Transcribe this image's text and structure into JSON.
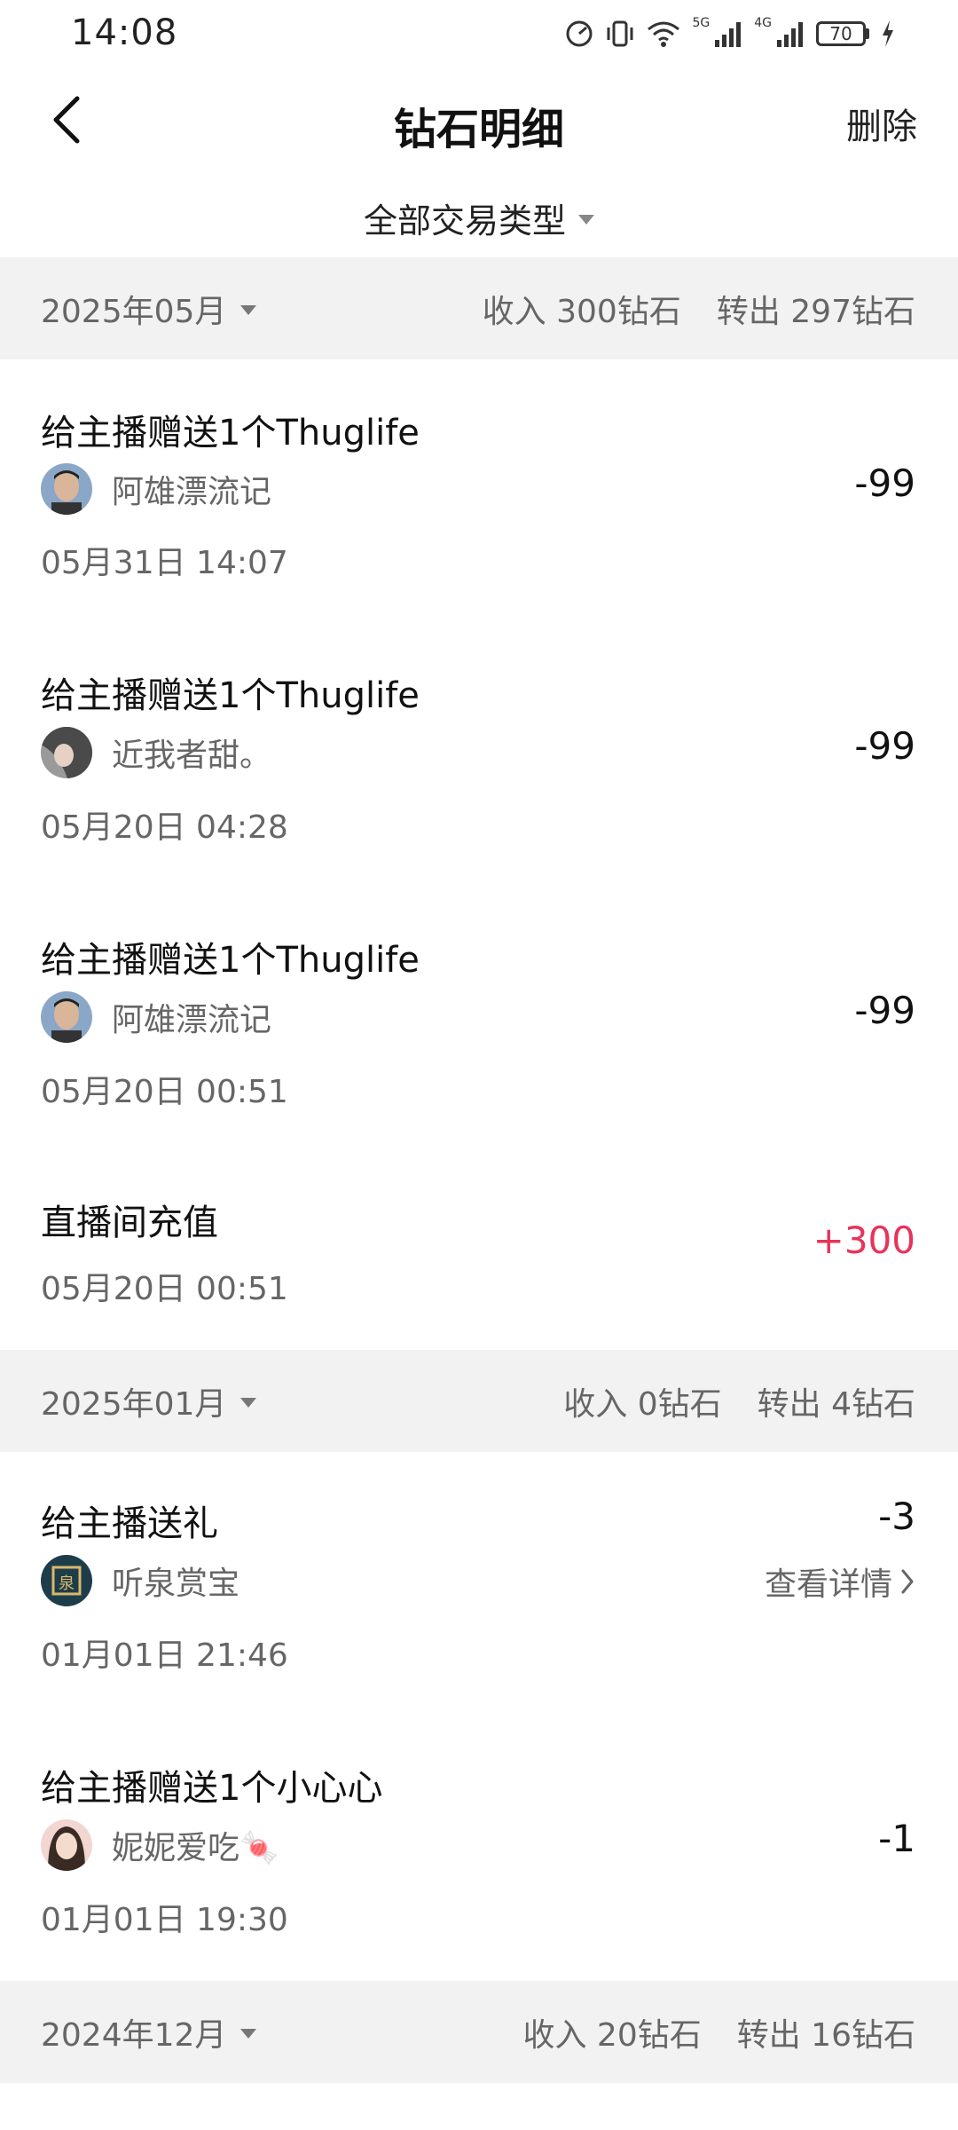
{
  "status_bar": {
    "time": "14:08",
    "battery": "70",
    "net_5g": "5G",
    "net_4g": "4G"
  },
  "header": {
    "title": "钻石明细",
    "delete_label": "删除",
    "back_icon": "chevron-left-icon"
  },
  "filter": {
    "label": "全部交易类型"
  },
  "months": [
    {
      "label": "2025年05月",
      "income": "收入 300钻石",
      "outgo": "转出 297钻石"
    },
    {
      "label": "2025年01月",
      "income": "收入 0钻石",
      "outgo": "转出 4钻石"
    },
    {
      "label": "2024年12月",
      "income": "收入 20钻石",
      "outgo": "转出 16钻石"
    }
  ],
  "transactions": [
    {
      "title": "给主播赠送1个Thuglife",
      "user": "阿雄漂流记",
      "time": "05月31日 14:07",
      "amount": "-99"
    },
    {
      "title": "给主播赠送1个Thuglife",
      "user": "近我者甜。",
      "time": "05月20日 04:28",
      "amount": "-99"
    },
    {
      "title": "给主播赠送1个Thuglife",
      "user": "阿雄漂流记",
      "time": "05月20日 00:51",
      "amount": "-99"
    },
    {
      "title": "直播间充值",
      "time": "05月20日 00:51",
      "amount": "+300"
    },
    {
      "title": "给主播送礼",
      "user": "听泉赏宝",
      "time": "01月01日 21:46",
      "amount": "-3",
      "detail": "查看详情"
    },
    {
      "title": "给主播赠送1个小心心",
      "user": "妮妮爱吃🍬",
      "time": "01月01日 19:30",
      "amount": "-1"
    }
  ],
  "colors": {
    "positive_amount": "#e8335a",
    "section_bg": "#f2f2f2",
    "secondary_text": "#666666"
  }
}
